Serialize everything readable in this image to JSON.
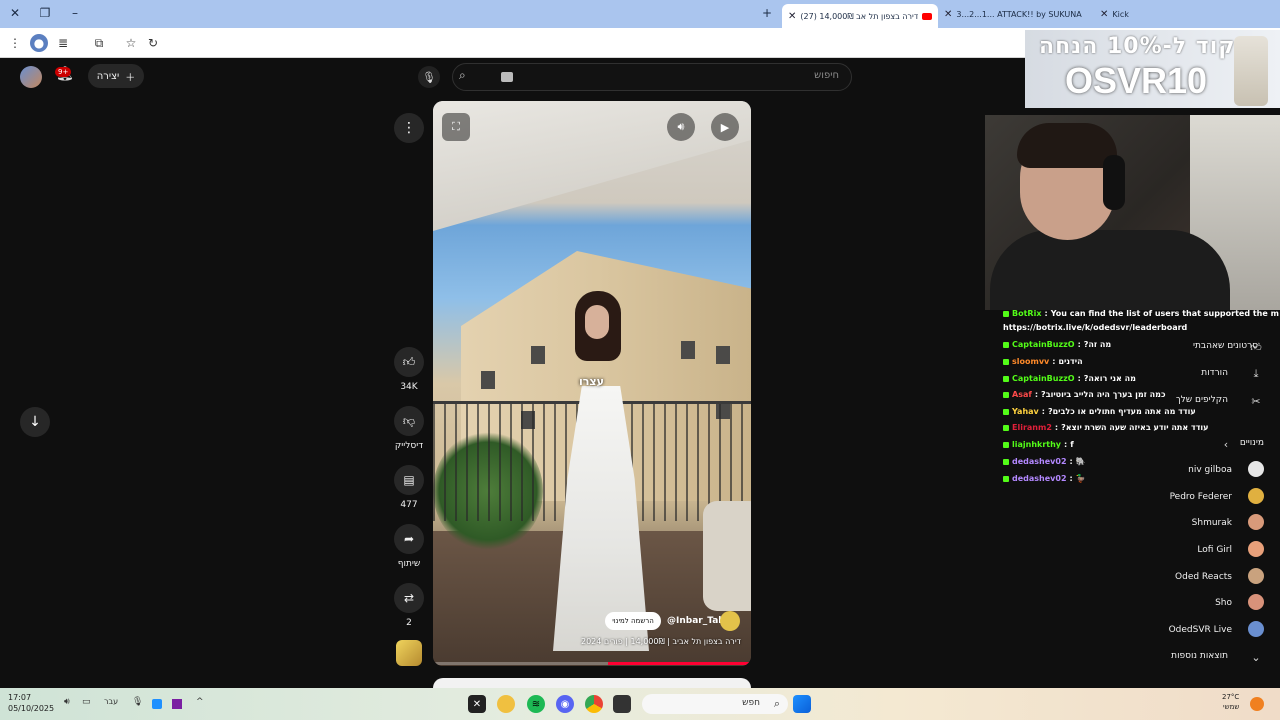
{
  "browser": {
    "tabs": [
      {
        "label": "Kick",
        "active": false
      },
      {
        "label": "3...2...1... ATTACK!! by SUKUNA",
        "active": false
      },
      {
        "label": "(27) דירה בצפון תל אב 14,000₪",
        "active": true
      }
    ]
  },
  "youtube": {
    "search_placeholder": "חיפוש",
    "create_label": "יצירה",
    "notifications_badge": "9+",
    "caption_overlay": "עצרו",
    "channel_handle": "@Inbar_Tal",
    "subscribe_label": "הרשמה למינוי",
    "video_title": "דירה בצפון תל אביב | 14,000₪ | פורים 2024",
    "progress_fraction": 0.45,
    "actions": {
      "likes": "34K",
      "dislike_label": "דיסלייק",
      "comments": "477",
      "share_label": "שיתוף",
      "remix_count": "2"
    },
    "sidebar": {
      "items": [
        "סרטונים שאהבתי",
        "הורדות",
        "הקליפים שלך"
      ],
      "subscriptions_header": "מינויים",
      "subscriptions": [
        "niv gilboa",
        "Pedro Federer",
        "Shmurak",
        "Lofi Girl",
        "Oded Reacts",
        "Sho",
        "OdedSVR Live"
      ],
      "show_more": "תוצאות נוספות"
    }
  },
  "stream_overlay": {
    "promo_line1": "קוד ל-10% הנחה",
    "promo_line2": "OSVR10",
    "chat": [
      {
        "user": "BotRix",
        "color": "#53fc18",
        "message": "You can find the list of users that supported the m"
      },
      {
        "user": "",
        "color": "#ffffff",
        "message": "https://botrix.live/k/odedsvr/leaderboard"
      },
      {
        "user": "CaptainBuzzO",
        "color": "#53fc18",
        "message": "מה זה?"
      },
      {
        "user": "sloomvv",
        "color": "#ff8a2a",
        "message": "הידנים"
      },
      {
        "user": "CaptainBuzzO",
        "color": "#53fc18",
        "message": "מה אני רואה?"
      },
      {
        "user": "Asaf",
        "color": "#ff4a4a",
        "message": "כמה זמן בערך היה הלייב ביוטיוב?"
      },
      {
        "user": "Yahav",
        "color": "#ffd23f",
        "message": "עודד מה אתה מעדיף חתולים או כלבים?"
      },
      {
        "user": "Eliranm2",
        "color": "#e0203a",
        "message": "עודד אתה יודע באיזה שעה השרת יוצא?"
      },
      {
        "user": "liajnhkrthy",
        "color": "#53fc18",
        "message": "f"
      },
      {
        "user": "dedashev02",
        "color": "#b388ff",
        "message": "🐘"
      },
      {
        "user": "dedashev02",
        "color": "#b388ff",
        "message": "🦆"
      }
    ]
  },
  "taskbar": {
    "time": "17:07",
    "date": "05/10/2025",
    "language": "עבר",
    "search_label": "חפש",
    "weather_temp": "27°C",
    "weather_desc": "שמשי"
  }
}
